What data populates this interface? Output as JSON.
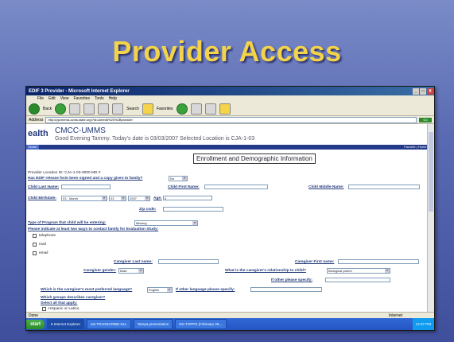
{
  "slide_title": "Provider Access",
  "window": {
    "title": "EDIF 3 Provider - Microsoft Internet Explorer",
    "controls": [
      "_",
      "□",
      "X"
    ]
  },
  "menu": [
    "File",
    "Edit",
    "View",
    "Favorites",
    "Tools",
    "Help"
  ],
  "toolbar": {
    "back": "Back",
    "search": "Search",
    "favorites": "Favorites"
  },
  "address": {
    "label": "Address",
    "value": "http://ppcmmss.ccms.state.org/?id=&med#%20%2Bprovider",
    "go": "Go"
  },
  "header": {
    "brand": "ealth",
    "app_name": "CMCC-UMMS",
    "greeting": "Good Evening Tammy. Today's date is 03/03/2007 Selected Location is CJA-1-03"
  },
  "nav": {
    "home": "Home",
    "right": "Favorite | Home | L"
  },
  "form": {
    "heading": "Enrollment and Demographic Information",
    "provider_location": "Provider Location ID: CJA-1-03-0000 MD #",
    "release_q": "Has EDIF release form been signed and a copy given to family?",
    "release_val": "No",
    "child_last": "Child Last Name:",
    "child_first": "Child First Name:",
    "child_middle": "Child Middle Name:",
    "birthdate": "Child Birthdate:",
    "bd_month": "03 - March",
    "bd_day": "03",
    "bd_year": "2007",
    "age_label": "Age:",
    "age_val": "0",
    "zip": "Zip code:",
    "program_q": "Type of Program that child will be entering:",
    "program_val": "Missing",
    "contact_q": "Please indicate at least two ways to contact family for Evaluation Study:",
    "contact_opts": [
      "telephone",
      "mail",
      "email"
    ],
    "cg_last": "Caregiver Last name:",
    "cg_first": "Caregiver First name:",
    "cg_gender": "Caregiver gender:",
    "cg_gender_val": "Male",
    "relation_q": "What is the caregiver's relationship to child?",
    "relation_val": "Biological parent",
    "other_specify": "If other please specify:",
    "language_q": "Which is the caregiver's most preferred language?",
    "language_val": "English",
    "other_lang": "If other language please specify:",
    "groups_q": "Which groups describes caregiver?",
    "select_all": "Select all that apply:",
    "group_opt": "Hispanic or Latino"
  },
  "statusbar": {
    "left": "Done",
    "zone": "Internet"
  },
  "taskbar": {
    "start": "start",
    "tasks": [
      "6 Internet Explorer",
      "sat TRANSCRIBE.DLL",
      "Tampa presentation",
      "NO TOPPS (February 26,..."
    ],
    "clock": "12:37 PM"
  }
}
